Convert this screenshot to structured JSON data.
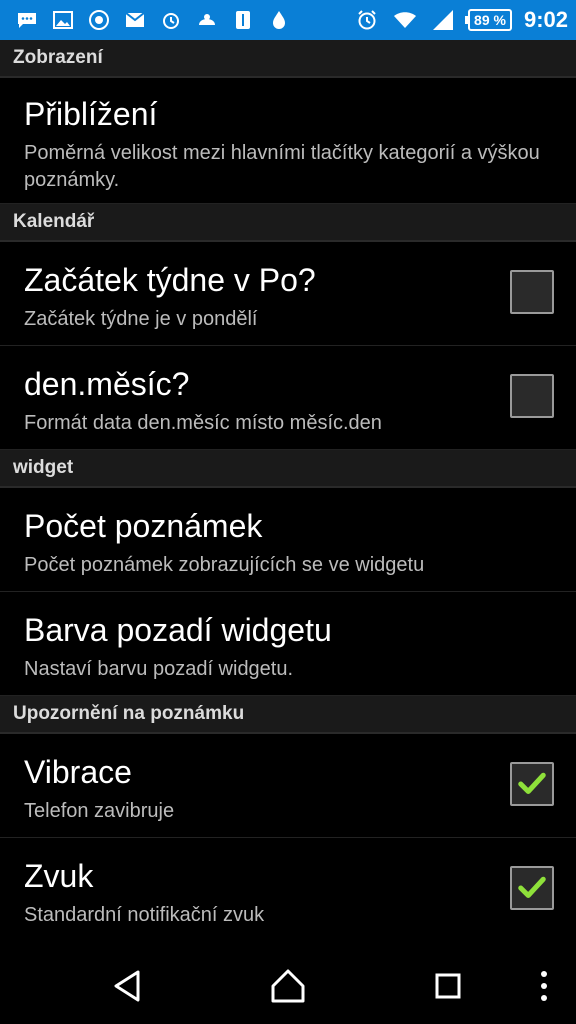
{
  "status_bar": {
    "left_icons": [
      "chat-icon",
      "gallery-icon",
      "app-icon",
      "gmail-icon",
      "alarm-app-icon",
      "weather-icon",
      "vertical-app-icon",
      "drop-icon"
    ],
    "right_icons": [
      "alarm-icon",
      "wifi-icon",
      "signal-icon"
    ],
    "battery": "89 %",
    "time": "9:02",
    "bg_color": "#0a7fd6"
  },
  "sections": [
    {
      "header": "Zobrazení",
      "items": [
        {
          "title": "Přiblížení",
          "summary": "Poměrná velikost mezi hlavními tlačítky kategorií a výškou poznámky.",
          "checkbox": null
        }
      ]
    },
    {
      "header": "Kalendář",
      "items": [
        {
          "title": "Začátek týdne v Po?",
          "summary": "Začátek týdne je v pondělí",
          "checkbox": false
        },
        {
          "title": "den.měsíc?",
          "summary": "Formát data den.měsíc místo měsíc.den",
          "checkbox": false
        }
      ]
    },
    {
      "header": "widget",
      "items": [
        {
          "title": "Počet poznámek",
          "summary": "Počet poznámek zobrazujících se ve widgetu",
          "checkbox": null
        },
        {
          "title": "Barva pozadí widgetu",
          "summary": "Nastaví barvu pozadí widgetu.",
          "checkbox": null
        }
      ]
    },
    {
      "header": "Upozornění na poznámku",
      "items": [
        {
          "title": "Vibrace",
          "summary": "Telefon zavibruje",
          "checkbox": true
        },
        {
          "title": "Zvuk",
          "summary": "Standardní notifikační zvuk",
          "checkbox": true
        }
      ]
    }
  ],
  "nav_bar": {
    "buttons": [
      "back-icon",
      "home-icon",
      "recents-icon",
      "overflow-menu-icon"
    ]
  },
  "colors": {
    "check_mark": "#8ee03a",
    "header_bg": "#1a1a1a"
  }
}
